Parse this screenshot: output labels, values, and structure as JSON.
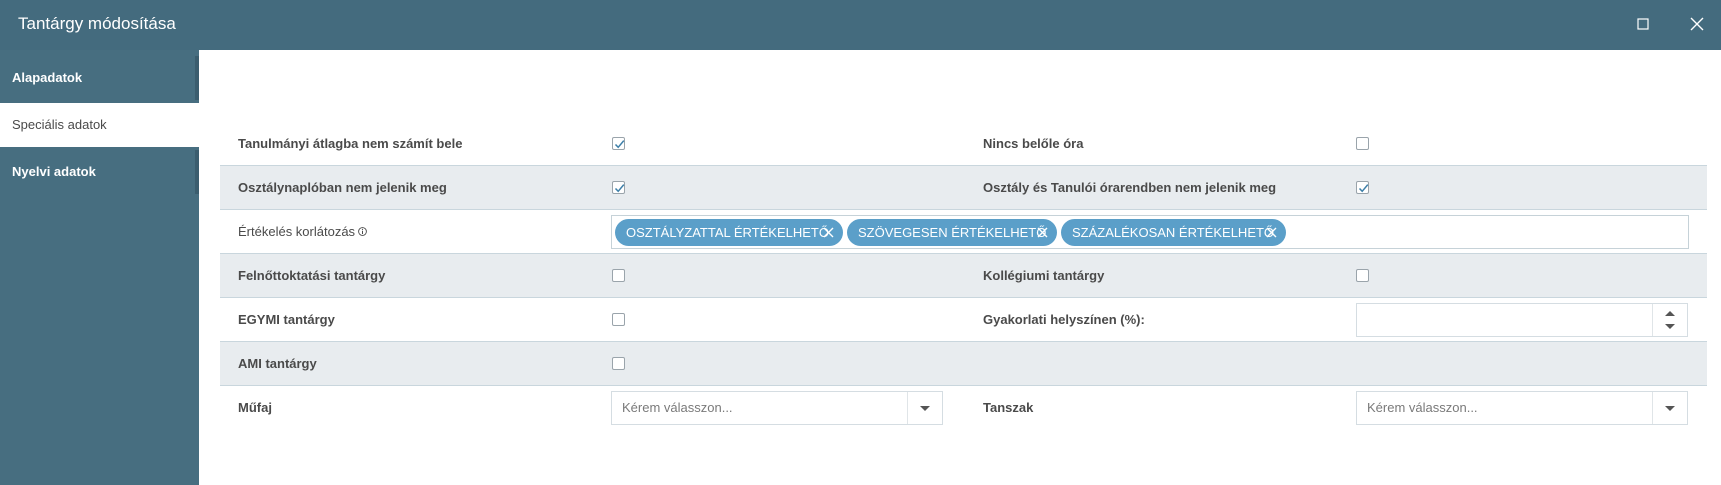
{
  "window": {
    "title": "Tantárgy módosítása",
    "maximize_icon": "maximize-icon",
    "close_icon": "close-icon"
  },
  "sidebar": {
    "items": [
      {
        "label": "Alapadatok",
        "state": "closed"
      },
      {
        "label": "Speciális adatok",
        "state": "active"
      },
      {
        "label": "Nyelvi adatok",
        "state": "closed"
      }
    ]
  },
  "form": {
    "tanulmanyi_atlag": {
      "label": "Tanulmányi átlagba nem számít bele",
      "checked": true
    },
    "nincs_orak": {
      "label": "Nincs belőle óra",
      "checked": false
    },
    "osztalynaplo": {
      "label": "Osztálynaplóban nem jelenik meg",
      "checked": true
    },
    "orarend": {
      "label": "Osztály és Tanulói órarendben nem jelenik meg",
      "checked": true
    },
    "ertekeles": {
      "label": "Értékelés korlátozás",
      "tags": [
        "OSZTÁLYZATTAL ÉRTÉKELHETŐ",
        "SZÖVEGESEN ÉRTÉKELHETŐ",
        "SZÁZALÉKOSAN ÉRTÉKELHETŐ"
      ]
    },
    "felnottoktatasi": {
      "label": "Felnőttoktatási tantárgy",
      "checked": false
    },
    "kollegiumi": {
      "label": "Kollégiumi tantárgy",
      "checked": false
    },
    "egymi": {
      "label": "EGYMI tantárgy",
      "checked": false
    },
    "gyakorlati": {
      "label": "Gyakorlati helyszínen (%):",
      "value": ""
    },
    "ami": {
      "label": "AMI tantárgy",
      "checked": false
    },
    "mufaj": {
      "label": "Műfaj",
      "placeholder": "Kérem válasszon..."
    },
    "tanszak": {
      "label": "Tanszak",
      "placeholder": "Kérem válasszon..."
    }
  },
  "colors": {
    "header": "#446b7e",
    "sidebar": "#476e80",
    "tag": "#5b9fc9",
    "row_shade": "#e8ecef"
  }
}
